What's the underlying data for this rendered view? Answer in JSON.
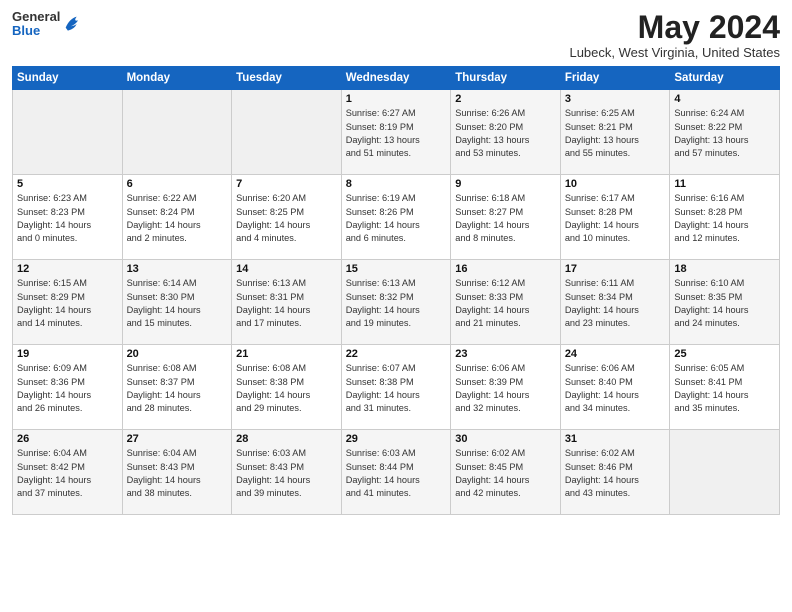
{
  "header": {
    "logo_general": "General",
    "logo_blue": "Blue",
    "month_title": "May 2024",
    "location": "Lubeck, West Virginia, United States"
  },
  "weekdays": [
    "Sunday",
    "Monday",
    "Tuesday",
    "Wednesday",
    "Thursday",
    "Friday",
    "Saturday"
  ],
  "weeks": [
    [
      {
        "day": "",
        "info": ""
      },
      {
        "day": "",
        "info": ""
      },
      {
        "day": "",
        "info": ""
      },
      {
        "day": "1",
        "info": "Sunrise: 6:27 AM\nSunset: 8:19 PM\nDaylight: 13 hours\nand 51 minutes."
      },
      {
        "day": "2",
        "info": "Sunrise: 6:26 AM\nSunset: 8:20 PM\nDaylight: 13 hours\nand 53 minutes."
      },
      {
        "day": "3",
        "info": "Sunrise: 6:25 AM\nSunset: 8:21 PM\nDaylight: 13 hours\nand 55 minutes."
      },
      {
        "day": "4",
        "info": "Sunrise: 6:24 AM\nSunset: 8:22 PM\nDaylight: 13 hours\nand 57 minutes."
      }
    ],
    [
      {
        "day": "5",
        "info": "Sunrise: 6:23 AM\nSunset: 8:23 PM\nDaylight: 14 hours\nand 0 minutes."
      },
      {
        "day": "6",
        "info": "Sunrise: 6:22 AM\nSunset: 8:24 PM\nDaylight: 14 hours\nand 2 minutes."
      },
      {
        "day": "7",
        "info": "Sunrise: 6:20 AM\nSunset: 8:25 PM\nDaylight: 14 hours\nand 4 minutes."
      },
      {
        "day": "8",
        "info": "Sunrise: 6:19 AM\nSunset: 8:26 PM\nDaylight: 14 hours\nand 6 minutes."
      },
      {
        "day": "9",
        "info": "Sunrise: 6:18 AM\nSunset: 8:27 PM\nDaylight: 14 hours\nand 8 minutes."
      },
      {
        "day": "10",
        "info": "Sunrise: 6:17 AM\nSunset: 8:28 PM\nDaylight: 14 hours\nand 10 minutes."
      },
      {
        "day": "11",
        "info": "Sunrise: 6:16 AM\nSunset: 8:28 PM\nDaylight: 14 hours\nand 12 minutes."
      }
    ],
    [
      {
        "day": "12",
        "info": "Sunrise: 6:15 AM\nSunset: 8:29 PM\nDaylight: 14 hours\nand 14 minutes."
      },
      {
        "day": "13",
        "info": "Sunrise: 6:14 AM\nSunset: 8:30 PM\nDaylight: 14 hours\nand 15 minutes."
      },
      {
        "day": "14",
        "info": "Sunrise: 6:13 AM\nSunset: 8:31 PM\nDaylight: 14 hours\nand 17 minutes."
      },
      {
        "day": "15",
        "info": "Sunrise: 6:13 AM\nSunset: 8:32 PM\nDaylight: 14 hours\nand 19 minutes."
      },
      {
        "day": "16",
        "info": "Sunrise: 6:12 AM\nSunset: 8:33 PM\nDaylight: 14 hours\nand 21 minutes."
      },
      {
        "day": "17",
        "info": "Sunrise: 6:11 AM\nSunset: 8:34 PM\nDaylight: 14 hours\nand 23 minutes."
      },
      {
        "day": "18",
        "info": "Sunrise: 6:10 AM\nSunset: 8:35 PM\nDaylight: 14 hours\nand 24 minutes."
      }
    ],
    [
      {
        "day": "19",
        "info": "Sunrise: 6:09 AM\nSunset: 8:36 PM\nDaylight: 14 hours\nand 26 minutes."
      },
      {
        "day": "20",
        "info": "Sunrise: 6:08 AM\nSunset: 8:37 PM\nDaylight: 14 hours\nand 28 minutes."
      },
      {
        "day": "21",
        "info": "Sunrise: 6:08 AM\nSunset: 8:38 PM\nDaylight: 14 hours\nand 29 minutes."
      },
      {
        "day": "22",
        "info": "Sunrise: 6:07 AM\nSunset: 8:38 PM\nDaylight: 14 hours\nand 31 minutes."
      },
      {
        "day": "23",
        "info": "Sunrise: 6:06 AM\nSunset: 8:39 PM\nDaylight: 14 hours\nand 32 minutes."
      },
      {
        "day": "24",
        "info": "Sunrise: 6:06 AM\nSunset: 8:40 PM\nDaylight: 14 hours\nand 34 minutes."
      },
      {
        "day": "25",
        "info": "Sunrise: 6:05 AM\nSunset: 8:41 PM\nDaylight: 14 hours\nand 35 minutes."
      }
    ],
    [
      {
        "day": "26",
        "info": "Sunrise: 6:04 AM\nSunset: 8:42 PM\nDaylight: 14 hours\nand 37 minutes."
      },
      {
        "day": "27",
        "info": "Sunrise: 6:04 AM\nSunset: 8:43 PM\nDaylight: 14 hours\nand 38 minutes."
      },
      {
        "day": "28",
        "info": "Sunrise: 6:03 AM\nSunset: 8:43 PM\nDaylight: 14 hours\nand 39 minutes."
      },
      {
        "day": "29",
        "info": "Sunrise: 6:03 AM\nSunset: 8:44 PM\nDaylight: 14 hours\nand 41 minutes."
      },
      {
        "day": "30",
        "info": "Sunrise: 6:02 AM\nSunset: 8:45 PM\nDaylight: 14 hours\nand 42 minutes."
      },
      {
        "day": "31",
        "info": "Sunrise: 6:02 AM\nSunset: 8:46 PM\nDaylight: 14 hours\nand 43 minutes."
      },
      {
        "day": "",
        "info": ""
      }
    ]
  ]
}
